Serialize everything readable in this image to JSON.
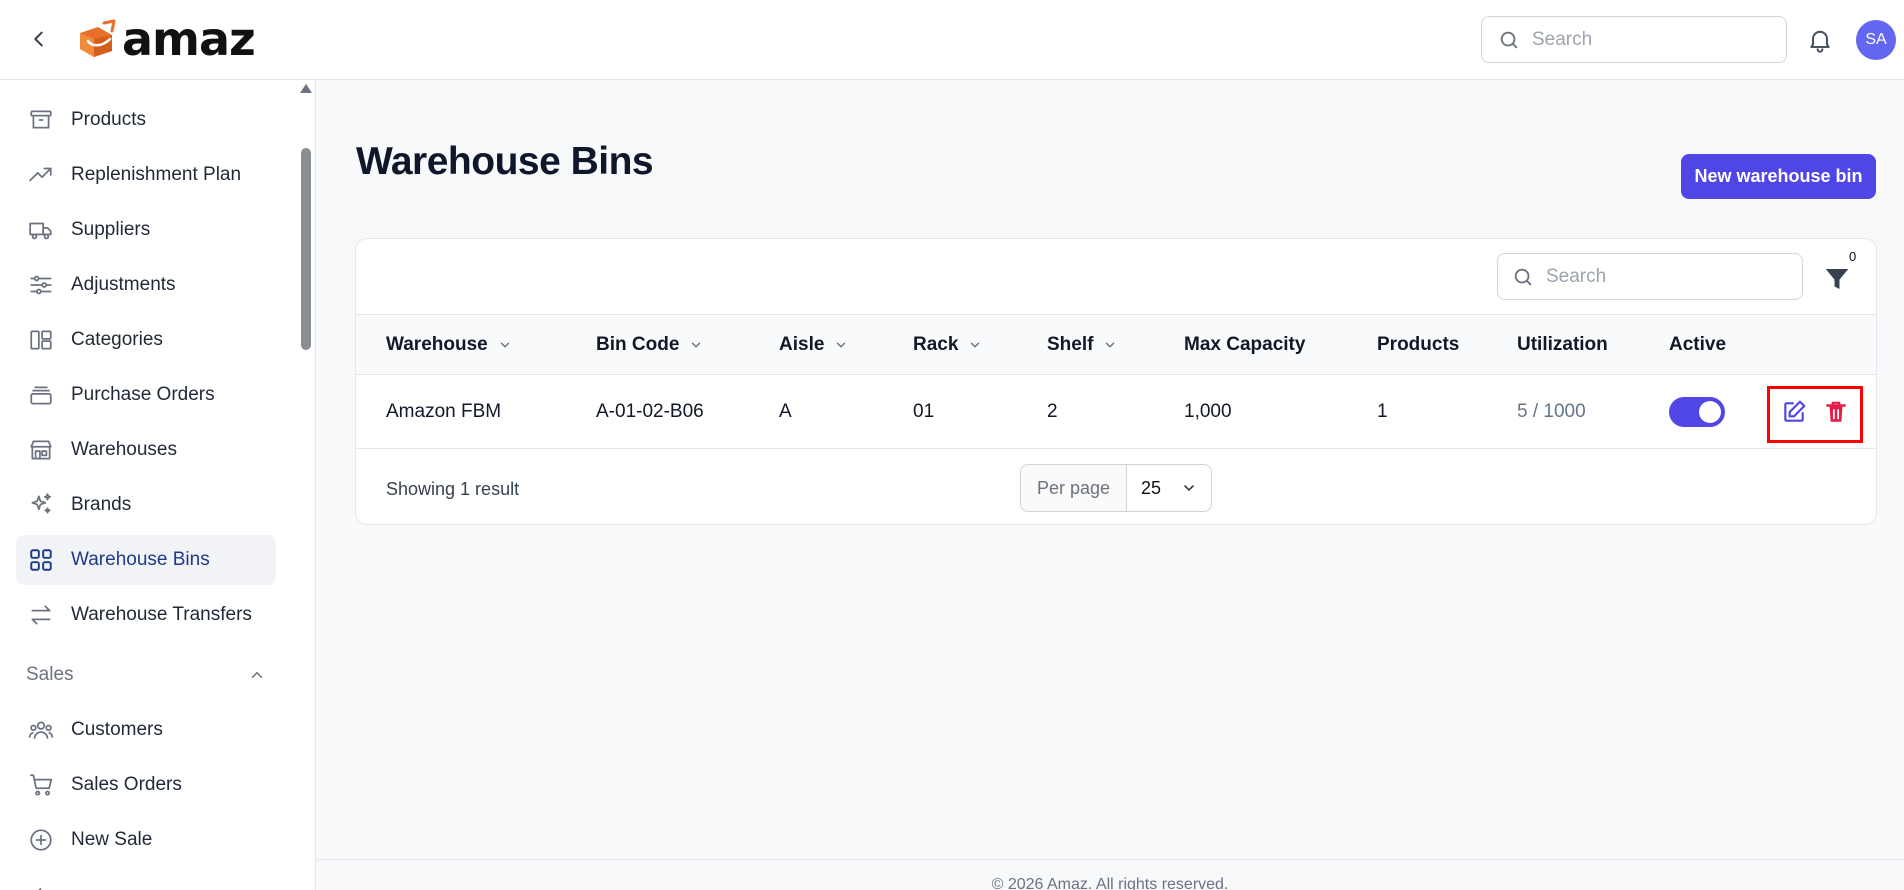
{
  "app": {
    "logo_text": "amaz",
    "avatar_initials": "SA"
  },
  "header": {
    "search_placeholder": "Search"
  },
  "sidebar": {
    "items": [
      {
        "label": "Products",
        "icon": "archive-box-icon"
      },
      {
        "label": "Replenishment Plan",
        "icon": "trend-up-icon"
      },
      {
        "label": "Suppliers",
        "icon": "truck-icon"
      },
      {
        "label": "Adjustments",
        "icon": "sliders-icon"
      },
      {
        "label": "Categories",
        "icon": "categories-icon"
      },
      {
        "label": "Purchase Orders",
        "icon": "stack-icon"
      },
      {
        "label": "Warehouses",
        "icon": "building-storefront-icon"
      },
      {
        "label": "Brands",
        "icon": "sparkles-icon"
      },
      {
        "label": "Warehouse Bins",
        "icon": "grid-icon",
        "active": true
      },
      {
        "label": "Warehouse Transfers",
        "icon": "arrows-exchange-icon"
      }
    ],
    "sales_section": "Sales",
    "sales_items": [
      {
        "label": "Customers",
        "icon": "users-icon"
      },
      {
        "label": "Sales Orders",
        "icon": "cart-icon"
      },
      {
        "label": "New Sale",
        "icon": "plus-circle-icon"
      }
    ]
  },
  "main": {
    "title": "Warehouse Bins",
    "new_button": "New warehouse bin",
    "table_search_placeholder": "Search",
    "filter_count": "0",
    "columns": [
      "Warehouse",
      "Bin Code",
      "Aisle",
      "Rack",
      "Shelf",
      "Max Capacity",
      "Products",
      "Utilization",
      "Active"
    ],
    "rows": [
      {
        "warehouse": "Amazon FBM",
        "bin_code": "A-01-02-B06",
        "aisle": "A",
        "rack": "01",
        "shelf": "2",
        "max_capacity": "1,000",
        "products": "1",
        "utilization": "5 / 1000",
        "active": true
      }
    ],
    "showing": "Showing 1 result",
    "per_page_label": "Per page",
    "per_page_value": "25"
  },
  "footer": {
    "text": "© 2026 Amaz. All rights reserved."
  },
  "colors": {
    "primary": "#4f46e5",
    "danger": "#e11d48",
    "highlight": "#ff0000"
  }
}
